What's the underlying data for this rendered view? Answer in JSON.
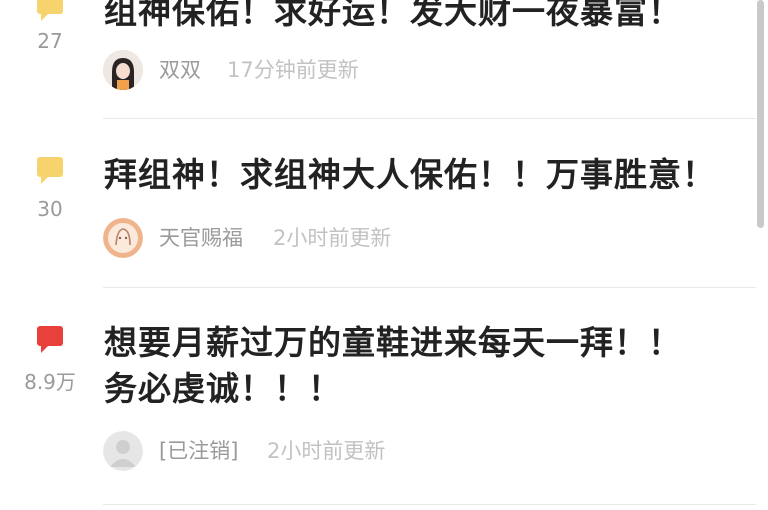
{
  "colors": {
    "badge_normal": "#f7d36d",
    "badge_hot": "#e8403a",
    "count_text": "#9a9a9a",
    "meta_text": "#c2c2c2"
  },
  "comments": [
    {
      "badge_icon": "comment-bubble-icon",
      "count": "27",
      "title": "组神保佑！求好运！发大财一夜暴富！",
      "username": "双双",
      "time": "17分钟前更新",
      "avatar_icon": "avatar-photo-icon"
    },
    {
      "badge_icon": "comment-bubble-icon",
      "count": "30",
      "title": "拜组神！求组神大人保佑！！万事胜意！",
      "username": "天官赐福",
      "time": "2小时前更新",
      "avatar_icon": "avatar-illustration-icon"
    },
    {
      "badge_icon": "comment-bubble-hot-icon",
      "count": "8.9万",
      "title_line1": "想要月薪过万的童鞋进来每天一拜！！",
      "title_line2": "务必虔诚！！！",
      "username": "[已注销]",
      "time": "2小时前更新",
      "avatar_icon": "default-avatar-icon"
    }
  ]
}
